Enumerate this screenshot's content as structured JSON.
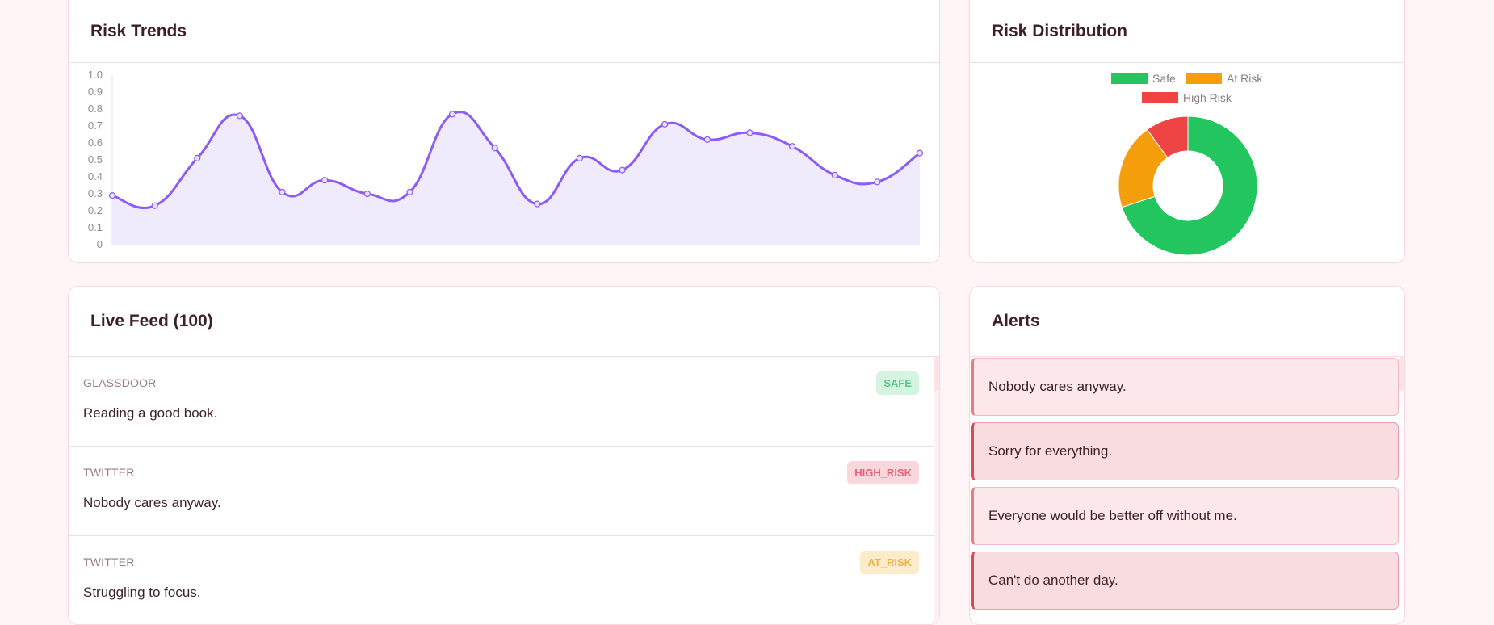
{
  "cards": {
    "trends": {
      "title": "Risk Trends"
    },
    "distribution": {
      "title": "Risk Distribution"
    },
    "feed": {
      "title": "Live Feed (100)"
    },
    "alerts": {
      "title": "Alerts"
    }
  },
  "colors": {
    "line": "#8b5cf6",
    "fill": "#efeafc",
    "safe": "#22c55e",
    "at_risk": "#f59e0b",
    "high_risk": "#ef4444"
  },
  "chart_data": [
    {
      "type": "line",
      "title": "Risk Trends",
      "ylim": [
        0,
        1.0
      ],
      "y_ticks": [
        "1.0",
        "0.9",
        "0.8",
        "0.7",
        "0.6",
        "0.5",
        "0.4",
        "0.3",
        "0.2",
        "0.1",
        "0"
      ],
      "series": [
        {
          "values": [
            0.29,
            0.23,
            0.51,
            0.76,
            0.31,
            0.38,
            0.3,
            0.31,
            0.77,
            0.57,
            0.24,
            0.51,
            0.44,
            0.71,
            0.62,
            0.66,
            0.58,
            0.41,
            0.37,
            0.54
          ]
        }
      ],
      "grid": false,
      "fill": true
    },
    {
      "type": "pie",
      "title": "Risk Distribution",
      "categories": [
        "Safe",
        "At Risk",
        "High Risk"
      ],
      "values": [
        70,
        20,
        10
      ],
      "legend": "top",
      "donut": true
    }
  ],
  "feed": [
    {
      "source": "GLASSDOOR",
      "text": "Reading a good book.",
      "badge": "SAFE",
      "level": "safe"
    },
    {
      "source": "TWITTER",
      "text": "Nobody cares anyway.",
      "badge": "HIGH_RISK",
      "level": "high"
    },
    {
      "source": "TWITTER",
      "text": "Struggling to focus.",
      "badge": "AT_RISK",
      "level": "at"
    }
  ],
  "alerts": [
    {
      "text": "Nobody cares anyway.",
      "tone": "light"
    },
    {
      "text": "Sorry for everything.",
      "tone": "dark"
    },
    {
      "text": "Everyone would be better off without me.",
      "tone": "light"
    },
    {
      "text": "Can't do another day.",
      "tone": "dark"
    }
  ]
}
